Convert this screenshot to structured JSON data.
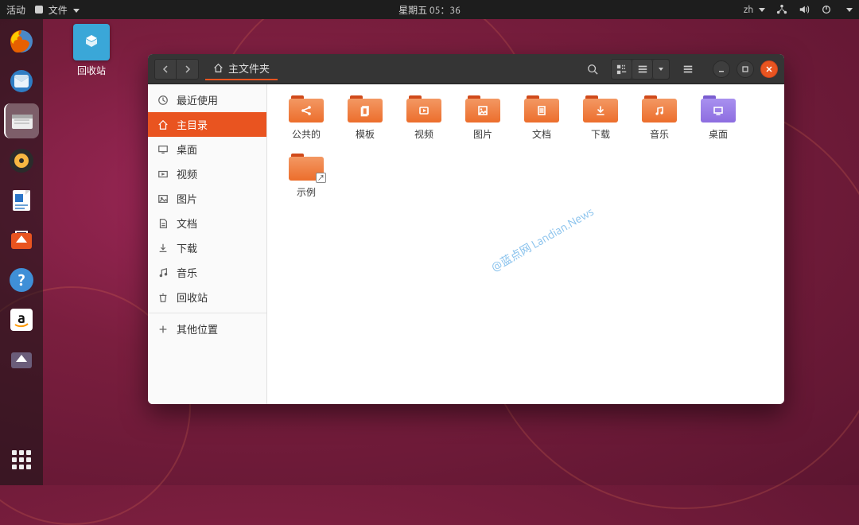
{
  "top_panel": {
    "activities": "活动",
    "app_menu": "文件",
    "clock": "星期五 05：36",
    "input": "zh"
  },
  "desktop": {
    "trash_label": "回收站"
  },
  "dock": {
    "items": [
      "firefox",
      "thunderbird",
      "files",
      "rhythmbox",
      "libreoffice-writer",
      "ubuntu-software",
      "help",
      "amazon",
      "software-updater"
    ],
    "apps_button": "show-applications"
  },
  "window": {
    "path_label": "主文件夹",
    "sidebar": [
      {
        "icon": "clock",
        "label": "最近使用"
      },
      {
        "icon": "home",
        "label": "主目录",
        "active": true
      },
      {
        "icon": "desktop",
        "label": "桌面"
      },
      {
        "icon": "video",
        "label": "视频"
      },
      {
        "icon": "picture",
        "label": "图片"
      },
      {
        "icon": "document",
        "label": "文档"
      },
      {
        "icon": "download",
        "label": "下载"
      },
      {
        "icon": "music",
        "label": "音乐"
      },
      {
        "icon": "trash",
        "label": "回收站"
      }
    ],
    "sidebar_other": "其他位置",
    "folders": [
      {
        "label": "公共的",
        "icon": "share",
        "style": "orange"
      },
      {
        "label": "模板",
        "icon": "template",
        "style": "orange"
      },
      {
        "label": "视频",
        "icon": "video",
        "style": "orange"
      },
      {
        "label": "图片",
        "icon": "picture",
        "style": "orange"
      },
      {
        "label": "文档",
        "icon": "document",
        "style": "orange"
      },
      {
        "label": "下载",
        "icon": "download",
        "style": "orange"
      },
      {
        "label": "音乐",
        "icon": "music",
        "style": "orange"
      },
      {
        "label": "桌面",
        "icon": "desktop",
        "style": "purple"
      },
      {
        "label": "示例",
        "icon": "generic",
        "style": "orange",
        "link": true
      }
    ]
  },
  "watermark": "@蓝点网 Landian.News"
}
